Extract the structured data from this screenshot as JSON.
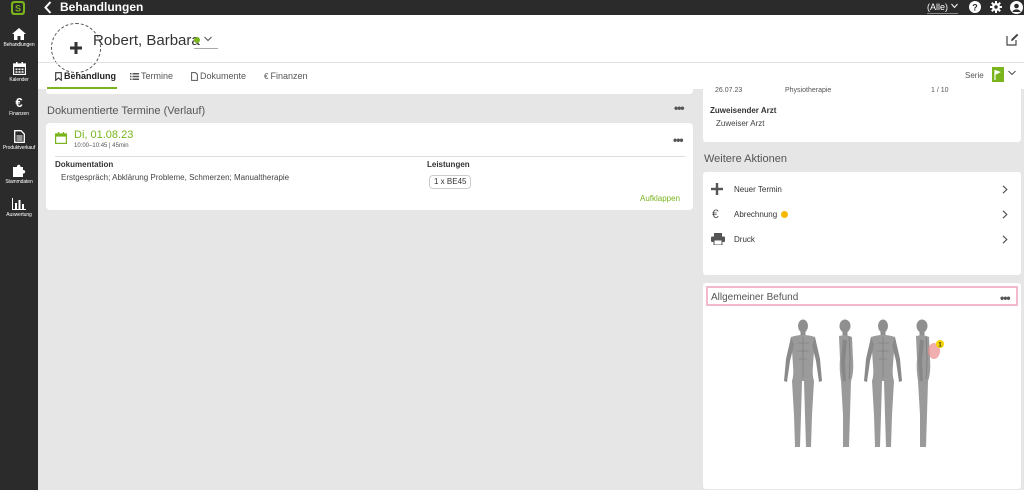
{
  "app": {
    "title": "Behandlungen",
    "filter_value": "(Alle)",
    "logo_letter": "S"
  },
  "sidebar": {
    "items": [
      {
        "label": "Behandlungen",
        "icon": "home-icon"
      },
      {
        "label": "Kalender",
        "icon": "calendar-icon"
      },
      {
        "label": "Finanzen",
        "icon": "euro-icon"
      },
      {
        "label": "Produktverkauf",
        "icon": "document-icon"
      },
      {
        "label": "Stammdaten",
        "icon": "puzzle-icon"
      },
      {
        "label": "Auswertung",
        "icon": "bar-chart-icon"
      }
    ]
  },
  "patient": {
    "name": "Robert, Barbara",
    "status_color": "#7ab51d"
  },
  "tabs": [
    {
      "label": "Behandlung",
      "icon": "bookmark-icon",
      "active": true
    },
    {
      "label": "Termine",
      "icon": "list-icon",
      "active": false
    },
    {
      "label": "Dokumente",
      "icon": "file-icon",
      "active": false
    },
    {
      "label": "Finanzen",
      "icon": "euro-icon",
      "active": false
    }
  ],
  "serie": {
    "label": "Serie"
  },
  "verlauf": {
    "title": "Dokumentierte Termine (Verlauf)",
    "entry": {
      "date": "Di, 01.08.23",
      "time": "10:00–10:45 | 45min",
      "doc_label": "Dokumentation",
      "doc_text": "Erstgespräch; Abklärung Probleme, Schmerzen; Manualtherapie",
      "leistungen_label": "Leistungen",
      "leistungen_value": "1 x BE45",
      "expand_label": "Aufklappen"
    }
  },
  "info": {
    "row_date": "26.07.23",
    "row_type": "Physiotherapie",
    "row_count": "1 / 10",
    "arzt_label": "Zuweisender Arzt",
    "arzt_value": "Zuweiser Arzt"
  },
  "aktionen": {
    "title": "Weitere Aktionen",
    "items": [
      {
        "label": "Neuer Termin",
        "icon": "plus-icon"
      },
      {
        "label": "Abrechnung",
        "icon": "euro-icon",
        "badge_color": "#f5b800"
      },
      {
        "label": "Druck",
        "icon": "printer-icon"
      }
    ]
  },
  "befund": {
    "title": "Allgemeiner Befund",
    "marker_number": "1"
  },
  "colors": {
    "accent": "#7ab51d",
    "dark": "#2b2b2b",
    "highlight_border": "#f2b8cc",
    "warning": "#f5b800"
  }
}
